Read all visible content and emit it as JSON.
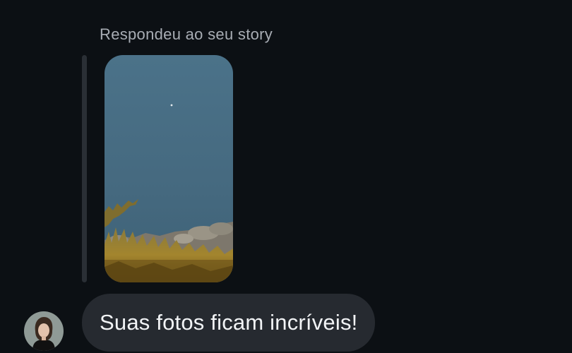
{
  "conversation": {
    "reply_context": "Respondeu ao seu story",
    "message": "Suas fotos ficam incríveis!"
  },
  "story_preview": {
    "description_icon": "story-photo",
    "sky_color": "#4a7086",
    "grass_color": "#a0822c"
  },
  "sender": {
    "avatar_icon": "user-avatar"
  },
  "colors": {
    "background": "#0c1014",
    "bubble": "#262a30",
    "secondary_text": "#a8adb4",
    "primary_text": "#f2f4f6"
  }
}
